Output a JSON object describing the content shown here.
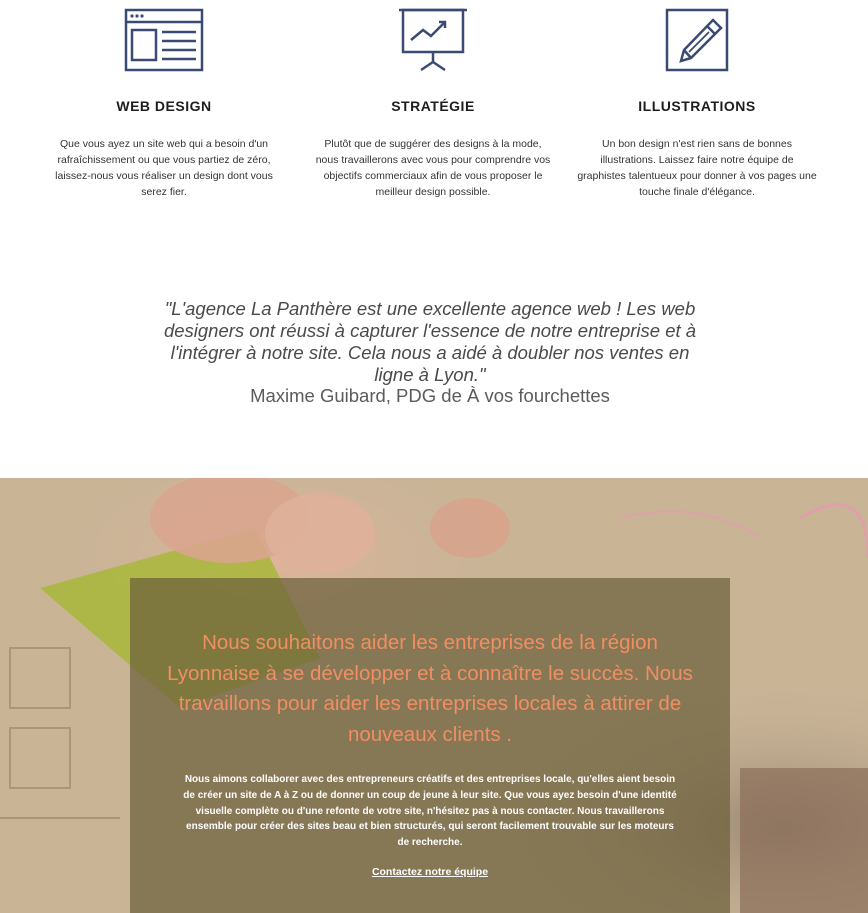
{
  "services": [
    {
      "icon": "browser-window-icon",
      "title": "WEB DESIGN",
      "text": "Que vous ayez un site web qui a besoin d'un rafraîchissement ou que vous partiez de zéro, laissez-nous vous réaliser un design dont vous serez fier."
    },
    {
      "icon": "presentation-chart-icon",
      "title": "STRATÉGIE",
      "text": "Plutôt que de suggérer des designs à la mode, nous travaillerons avec vous pour comprendre vos objectifs commerciaux afin de vous proposer le meilleur design possible."
    },
    {
      "icon": "pencil-icon",
      "title": "ILLUSTRATIONS",
      "text": "Un bon design n'est rien sans de bonnes illustrations. Laissez faire notre équipe de graphistes talentueux pour donner à vos pages une touche finale d'élégance."
    }
  ],
  "testimonial": {
    "quote": "\"L'agence La Panthère est une excellente agence web ! Les web designers ont réussi à capturer l'essence de notre entreprise et à l'intégrer à notre site. Cela nous a aidé à doubler nos ventes en ligne à Lyon.\"",
    "author": "Maxime Guibard, PDG de À vos fourchettes"
  },
  "hero": {
    "headline": "Nous souhaitons aider les entreprises de la région Lyonnaise à se développer et à connaître le succès. Nous travaillons pour aider les entreprises locales à attirer de nouveaux clients .",
    "body": "Nous aimons collaborer avec des entrepreneurs créatifs et des entreprises locale, qu'elles aient besoin de créer un site de A à Z ou de donner un coup de jeune à leur site. Que vous ayez besoin d'une identité visuelle complète ou d'une refonte de votre site, n'hésitez pas à nous contacter. Nous travaillerons ensemble pour créer des sites beau et bien structurés, qui seront facilement trouvable sur les moteurs de recherche.",
    "cta_label": "Contactez notre équipe"
  },
  "colors": {
    "icon_stroke": "#3b4a73",
    "headline": "#f18e62",
    "overlay": "#6c603c"
  }
}
